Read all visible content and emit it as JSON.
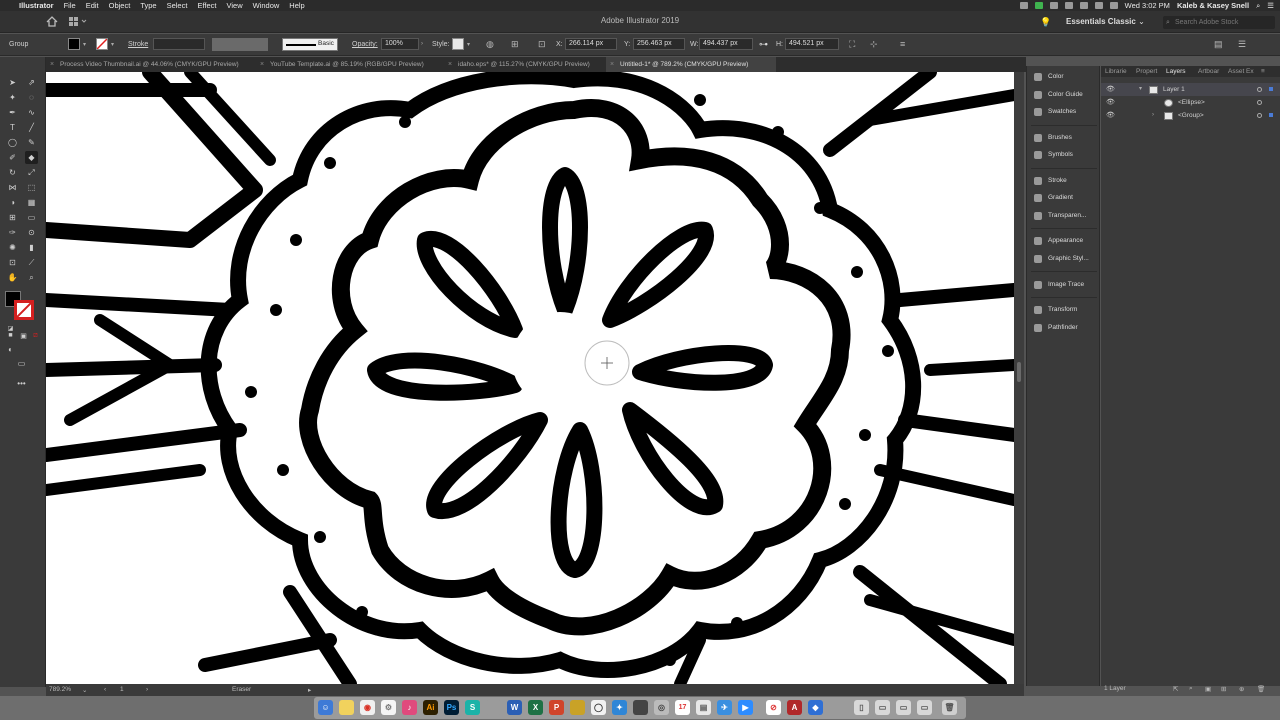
{
  "menubar": {
    "app": "Illustrator",
    "menus": [
      "File",
      "Edit",
      "Object",
      "Type",
      "Select",
      "Effect",
      "View",
      "Window",
      "Help"
    ],
    "clock": "Wed 3:02 PM",
    "user": "Kaleb & Kasey Snell"
  },
  "titlebar": {
    "title": "Adobe Illustrator 2019",
    "workspace": "Essentials Classic",
    "search_placeholder": "Search Adobe Stock"
  },
  "controlbar": {
    "selection": "Group",
    "stroke_label": "Stroke",
    "brush": "Basic",
    "opacity_label": "Opacity:",
    "opacity": "100%",
    "style_label": "Style:",
    "x_label": "X:",
    "x": "266.114 px",
    "y_label": "Y:",
    "y": "256.463 px",
    "w_label": "W:",
    "w": "494.437 px",
    "h_label": "H:",
    "h": "494.521 px"
  },
  "tabs": [
    {
      "label": "Process Video Thumbnail.ai @ 44.06% (CMYK/GPU Preview)"
    },
    {
      "label": "YouTube Template.ai @ 85.19% (RGB/GPU Preview)"
    },
    {
      "label": "idaho.eps* @ 115.27% (CMYK/GPU Preview)"
    },
    {
      "label": "Untitled-1* @ 789.2% (CMYK/GPU Preview)"
    }
  ],
  "statusbar": {
    "zoom": "789.2%",
    "artboard": "1",
    "tool": "Eraser"
  },
  "dock_panels": [
    {
      "label": "Color",
      "icon": "color-icon"
    },
    {
      "label": "Color Guide",
      "icon": "color-guide-icon"
    },
    {
      "label": "Swatches",
      "icon": "swatches-icon"
    },
    {
      "label": "Brushes",
      "icon": "brushes-icon"
    },
    {
      "label": "Symbols",
      "icon": "symbols-icon"
    },
    {
      "label": "Stroke",
      "icon": "stroke-icon"
    },
    {
      "label": "Gradient",
      "icon": "gradient-icon"
    },
    {
      "label": "Transparen...",
      "icon": "transparency-icon"
    },
    {
      "label": "Appearance",
      "icon": "appearance-icon"
    },
    {
      "label": "Graphic Styl...",
      "icon": "graphic-styles-icon"
    },
    {
      "label": "Image Trace",
      "icon": "image-trace-icon"
    },
    {
      "label": "Transform",
      "icon": "transform-icon"
    },
    {
      "label": "Pathfinder",
      "icon": "pathfinder-icon"
    }
  ],
  "layers_panel": {
    "tabs": [
      "Librarie",
      "Propert",
      "Layers",
      "Artboar",
      "Asset Ex"
    ],
    "active_tab": "Layers",
    "rows": [
      {
        "name": "Layer 1"
      },
      {
        "name": "<Ellipse>"
      },
      {
        "name": "<Group>"
      }
    ],
    "footer": "1 Layer"
  },
  "colors": {
    "ui_dark": "#3a3a3a",
    "selection_blue": "#4a7bd6",
    "artwork": "#000000"
  }
}
